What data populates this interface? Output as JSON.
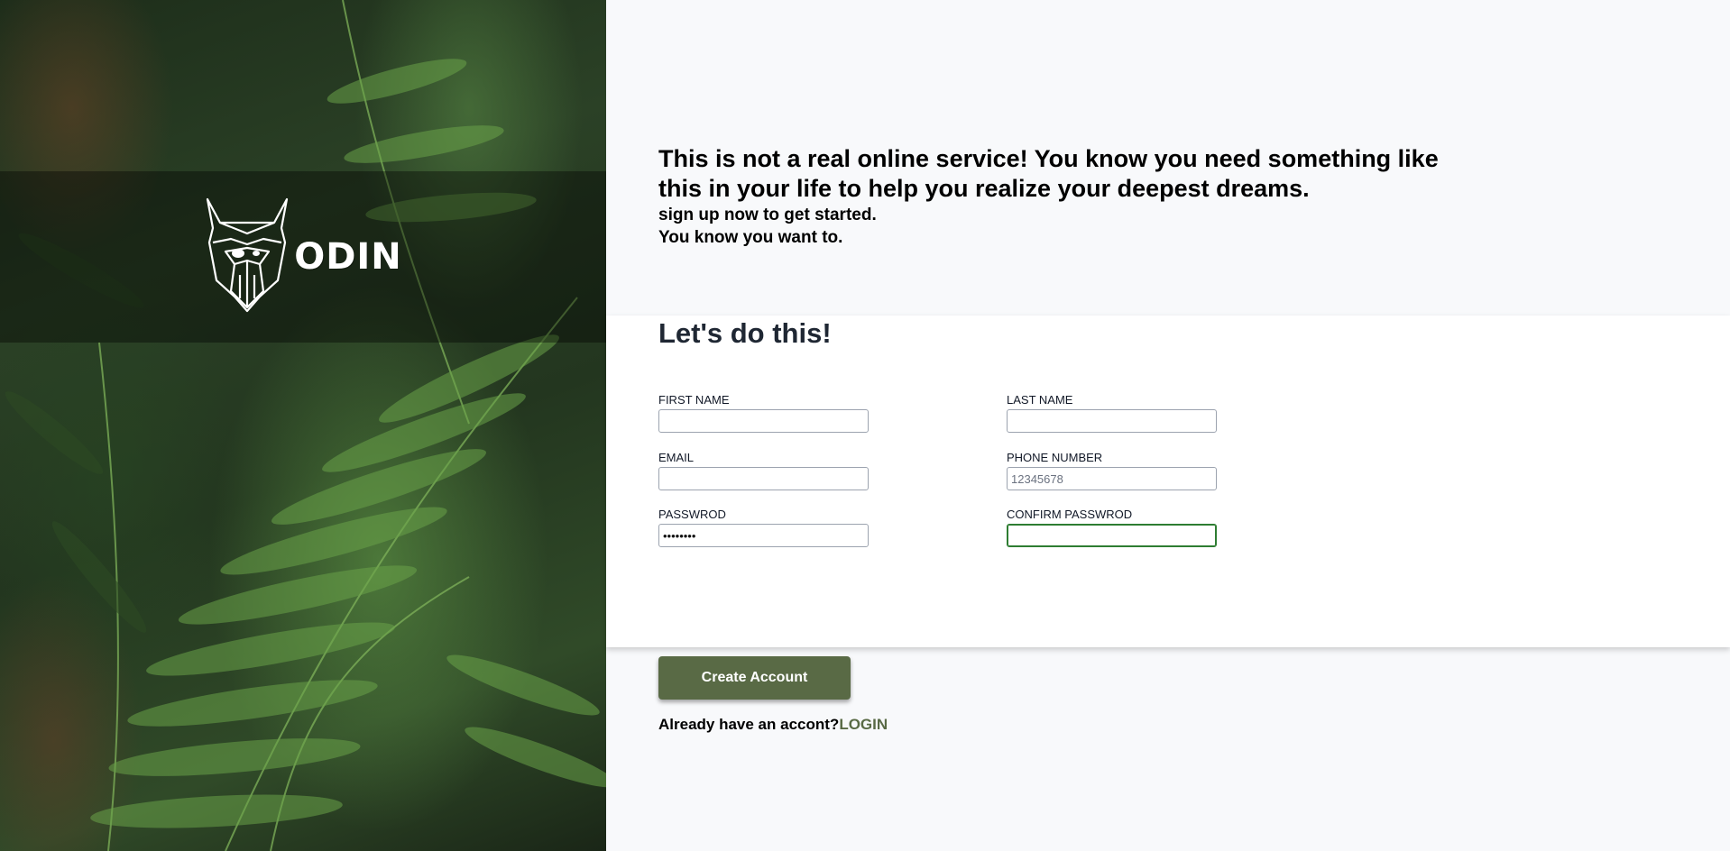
{
  "brand": {
    "name": "ODIN",
    "logo_icon": "viking-head-icon"
  },
  "intro": {
    "headline": "This is not a real online service! You know you need something like this in your life to help you realize your deepest dreams.",
    "sub_line_1": "sign up now to get started.",
    "sub_line_2": "You know you want to."
  },
  "form": {
    "title": "Let's do this!",
    "fields": {
      "first_name": {
        "label": "FIRST NAME",
        "value": "",
        "placeholder": ""
      },
      "last_name": {
        "label": "LAST NAME",
        "value": "",
        "placeholder": ""
      },
      "email": {
        "label": "EMAIL",
        "value": "",
        "placeholder": ""
      },
      "phone": {
        "label": "PHONE NUMBER",
        "value": "",
        "placeholder": "12345678"
      },
      "password": {
        "label": "PASSWROD",
        "value": "••••••••",
        "placeholder": ""
      },
      "confirm_password": {
        "label": "CONFIRM PASSWROD",
        "value": "",
        "placeholder": ""
      }
    }
  },
  "actions": {
    "create_label": "Create Account",
    "login_prompt": "Already have an accont?",
    "login_link": "LOGIN"
  },
  "colors": {
    "accent": "#596a45",
    "focus": "#2e7d32",
    "background": "#f8f9fb"
  }
}
